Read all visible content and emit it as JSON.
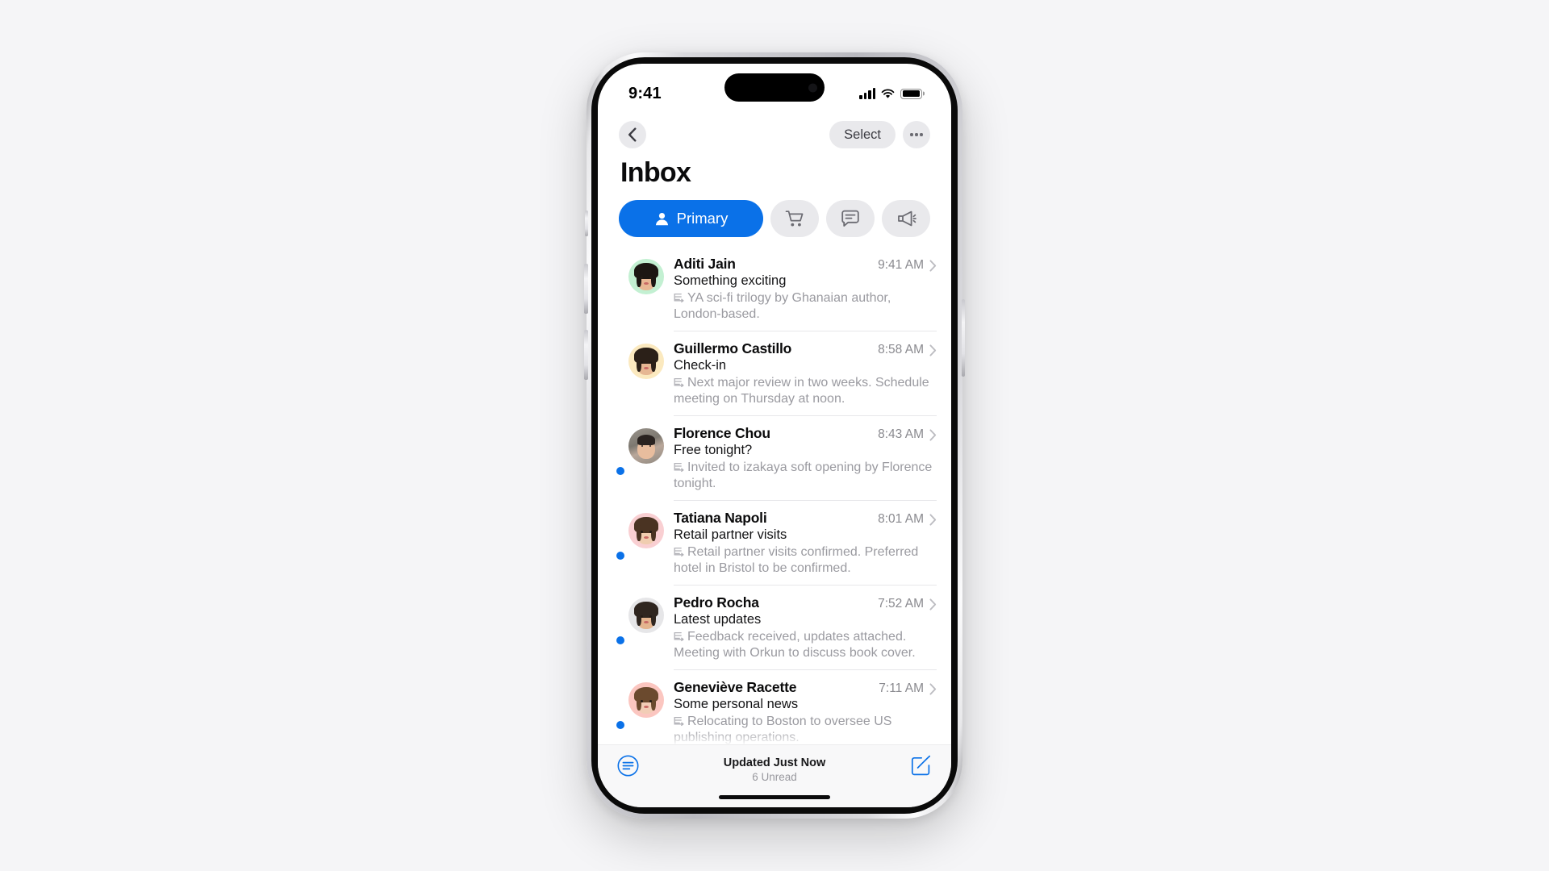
{
  "status_bar": {
    "time": "9:41",
    "signal_icon": "cellular-bars-icon",
    "wifi_icon": "wifi-icon",
    "battery_icon": "battery-icon"
  },
  "nav": {
    "back_icon": "chevron-left-icon",
    "select_label": "Select",
    "more_icon": "ellipsis-icon"
  },
  "header": {
    "title": "Inbox"
  },
  "tabs": [
    {
      "id": "primary",
      "label": "Primary",
      "icon": "person-icon",
      "active": true
    },
    {
      "id": "promotions",
      "label": "",
      "icon": "cart-icon",
      "active": false
    },
    {
      "id": "social",
      "label": "",
      "icon": "chat-bubble-icon",
      "active": false
    },
    {
      "id": "updates",
      "label": "",
      "icon": "megaphone-icon",
      "active": false
    }
  ],
  "colors": {
    "accent_blue": "#0a71e8",
    "chip_gray": "#e9e9ec",
    "text_primary": "#0b0b0c",
    "text_secondary": "#9a9aa0",
    "unread_dot": "#0a71e8"
  },
  "emails": [
    {
      "sender": "Aditi Jain",
      "time": "9:41 AM",
      "subject": "Something exciting",
      "preview": "YA sci-fi trilogy by Ghanaian author, London-based.",
      "unread": false,
      "avatar_bg": "#c3f0d2",
      "avatar_type": "memoji",
      "chevron_icon": "chevron-right-icon",
      "summary_icon": "summary-icon"
    },
    {
      "sender": "Guillermo Castillo",
      "time": "8:58 AM",
      "subject": "Check-in",
      "preview": "Next major review in two weeks. Schedule meeting on Thursday at noon.",
      "unread": false,
      "avatar_bg": "#fbe9bf",
      "avatar_type": "memoji",
      "chevron_icon": "chevron-right-icon",
      "summary_icon": "summary-icon"
    },
    {
      "sender": "Florence Chou",
      "time": "8:43 AM",
      "subject": "Free tonight?",
      "preview": "Invited to izakaya soft opening by Florence tonight.",
      "unread": true,
      "avatar_bg": "#8f8d86",
      "avatar_type": "photo",
      "chevron_icon": "chevron-right-icon",
      "summary_icon": "summary-icon"
    },
    {
      "sender": "Tatiana Napoli",
      "time": "8:01 AM",
      "subject": "Retail partner visits",
      "preview": "Retail partner visits confirmed. Preferred hotel in Bristol to be confirmed.",
      "unread": true,
      "avatar_bg": "#f9cfd2",
      "avatar_type": "memoji",
      "chevron_icon": "chevron-right-icon",
      "summary_icon": "summary-icon"
    },
    {
      "sender": "Pedro Rocha",
      "time": "7:52 AM",
      "subject": "Latest updates",
      "preview": "Feedback received, updates attached. Meeting with Orkun to discuss book cover.",
      "unread": true,
      "avatar_bg": "#e6e6e8",
      "avatar_type": "memoji",
      "chevron_icon": "chevron-right-icon",
      "summary_icon": "summary-icon"
    },
    {
      "sender": "Geneviève Racette",
      "time": "7:11 AM",
      "subject": "Some personal news",
      "preview": "Relocating to Boston to oversee US publishing operations.",
      "unread": true,
      "avatar_bg": "#fbc6c0",
      "avatar_type": "memoji",
      "chevron_icon": "chevron-right-icon",
      "summary_icon": "summary-icon"
    }
  ],
  "footer": {
    "filter_icon": "filter-icon",
    "status_main": "Updated Just Now",
    "status_sub": "6 Unread",
    "compose_icon": "compose-icon"
  }
}
